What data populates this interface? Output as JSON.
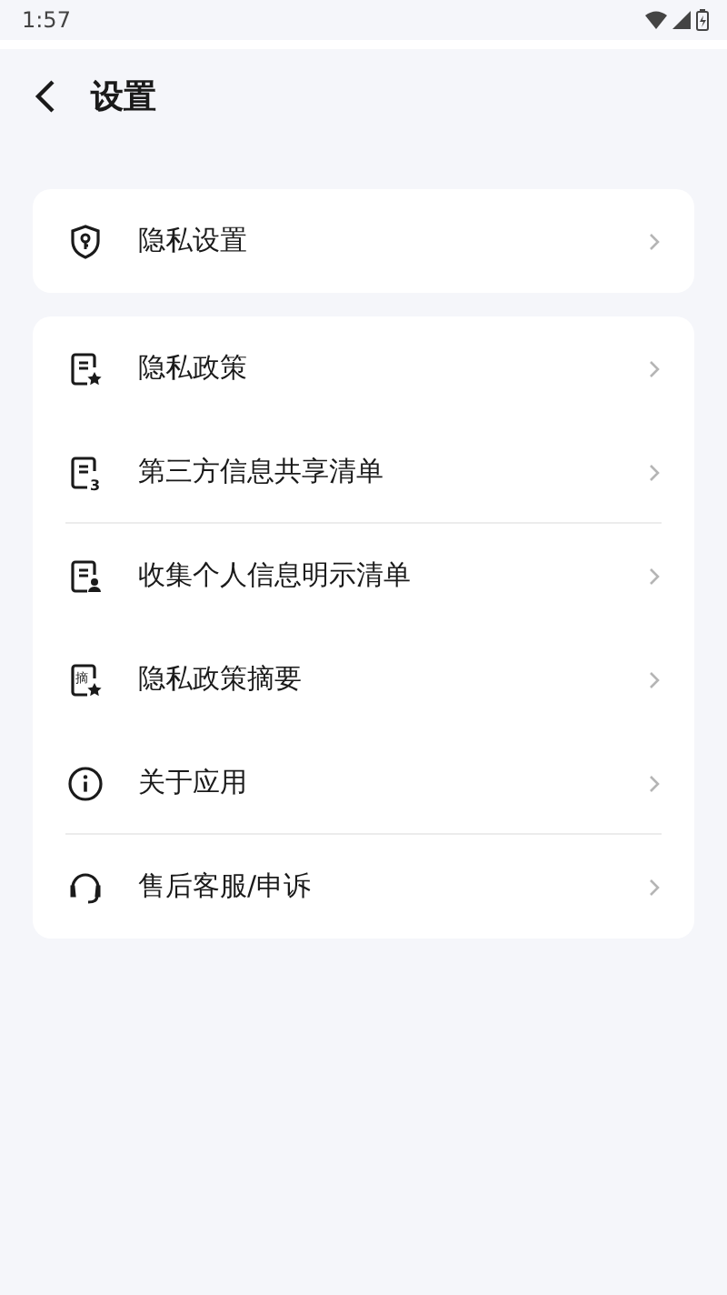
{
  "status_bar": {
    "time": "1:57"
  },
  "header": {
    "title": "设置"
  },
  "groups": [
    {
      "items": [
        {
          "label": "隐私设置",
          "kind": "shield",
          "divider": false
        }
      ]
    },
    {
      "items": [
        {
          "label": "隐私政策",
          "kind": "star",
          "divider": false
        },
        {
          "label": "第三方信息共享清单",
          "kind": "number",
          "icon_text": "3",
          "divider": true
        },
        {
          "label": "收集个人信息明示清单",
          "kind": "person",
          "divider": false
        },
        {
          "label": "隐私政策摘要",
          "kind": "summary",
          "icon_text": "摘",
          "divider": false
        },
        {
          "label": "关于应用",
          "kind": "info",
          "divider": true
        },
        {
          "label": "售后客服/申诉",
          "kind": "support",
          "divider": false
        }
      ]
    }
  ]
}
